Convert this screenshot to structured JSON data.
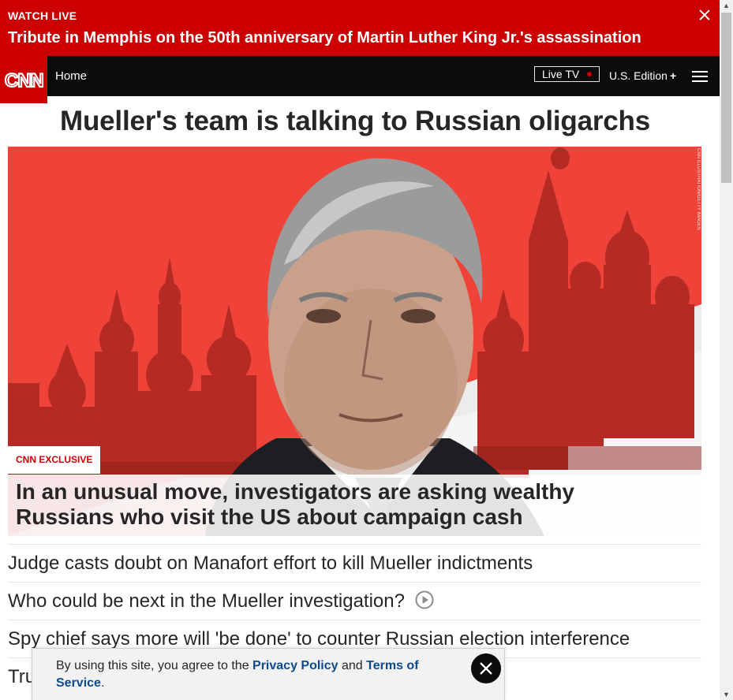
{
  "live_banner": {
    "label": "WATCH LIVE",
    "headline": "Tribute in Memphis on the 50th anniversary of Martin Luther King Jr.'s assassination"
  },
  "nav": {
    "logo": "CNN",
    "home": "Home",
    "live_tv": "Live TV",
    "edition": "U.S. Edition",
    "edition_plus": "+"
  },
  "main": {
    "title": "Mueller's team is talking to Russian oligarchs",
    "photo_credit": "CNN ILLUSTRATION/GETTY IMAGES",
    "tag": "CNN EXCLUSIVE",
    "caption": "In an unusual move, investigators are asking wealthy Russians who visit the US about campaign cash"
  },
  "related": [
    {
      "text": "Judge casts doubt on Manafort effort to kill Mueller indictments"
    },
    {
      "text": "Who could be next in the Mueller investigation?",
      "icon": "play-icon"
    },
    {
      "text": "Spy chief says more will 'be done' to counter Russian election interference"
    },
    {
      "text": "Tru"
    }
  ],
  "cookie": {
    "prefix": "By using this site, you agree to the ",
    "privacy": "Privacy Policy",
    "and": " and ",
    "terms": "Terms of Service",
    "suffix": "."
  },
  "colors": {
    "brand_red": "#cc0000",
    "nav_black": "#0c0c0c",
    "link_blue": "#0c4a8f"
  }
}
